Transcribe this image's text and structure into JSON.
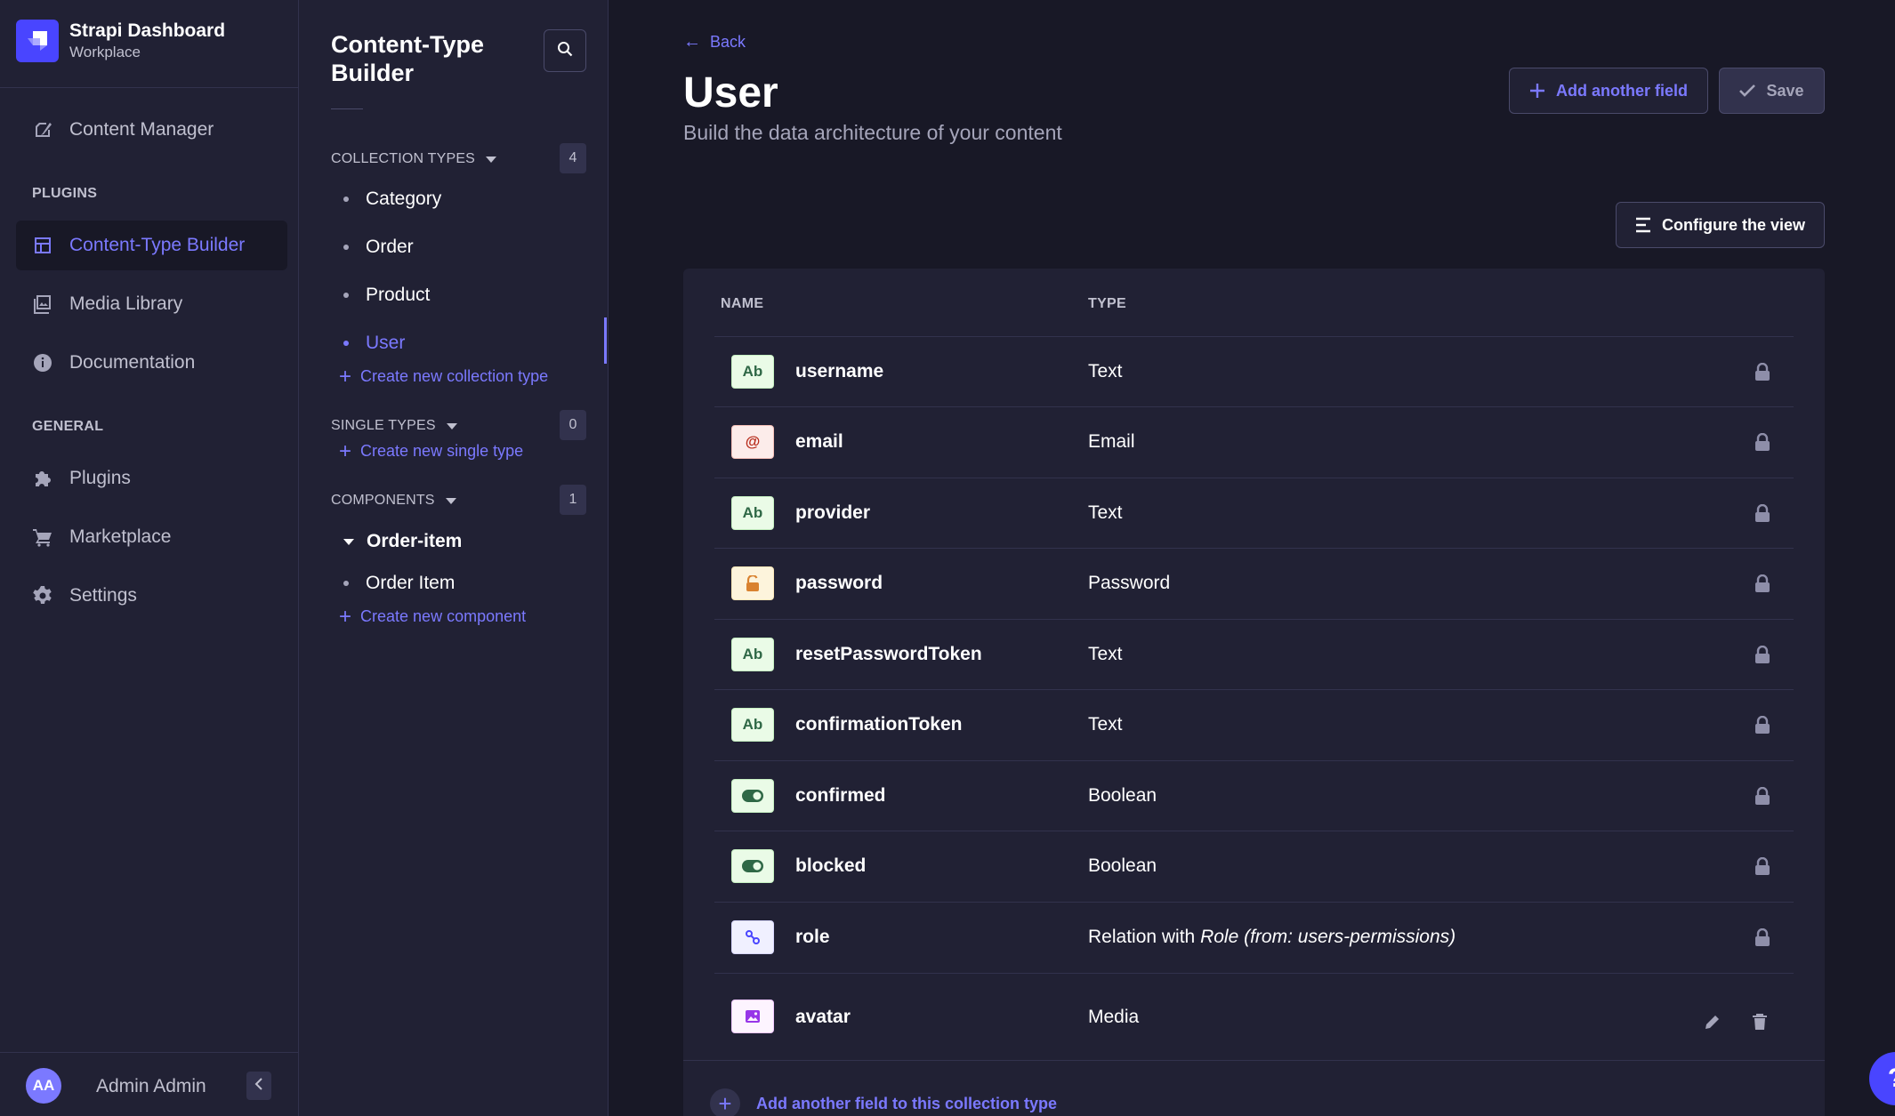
{
  "brand": {
    "title": "Strapi Dashboard",
    "subtitle": "Workplace"
  },
  "main_nav": {
    "content_manager": "Content Manager",
    "plugins_section": "PLUGINS",
    "content_type_builder": "Content-Type Builder",
    "media_library": "Media Library",
    "documentation": "Documentation",
    "general_section": "GENERAL",
    "plugins": "Plugins",
    "marketplace": "Marketplace",
    "settings": "Settings"
  },
  "user": {
    "initials": "AA",
    "name": "Admin Admin"
  },
  "sub_nav": {
    "title_line1": "Content-Type",
    "title_line2": "Builder",
    "collection_types": {
      "label": "COLLECTION TYPES",
      "count": "4",
      "items": [
        "Category",
        "Order",
        "Product",
        "User"
      ],
      "active": "User",
      "create": "Create new collection type"
    },
    "single_types": {
      "label": "SINGLE TYPES",
      "count": "0",
      "create": "Create new single type"
    },
    "components": {
      "label": "COMPONENTS",
      "count": "1",
      "group": "Order-item",
      "items": [
        "Order Item"
      ],
      "create": "Create new component"
    }
  },
  "header": {
    "back": "Back",
    "title": "User",
    "subtitle": "Build the data architecture of your content",
    "add_field": "Add another field",
    "save": "Save",
    "configure": "Configure the view"
  },
  "table": {
    "col_name": "NAME",
    "col_type": "TYPE",
    "rows": [
      {
        "name": "username",
        "type": "Text",
        "icon_label": "Ab"
      },
      {
        "name": "email",
        "type": "Email",
        "icon_label": "@"
      },
      {
        "name": "provider",
        "type": "Text",
        "icon_label": "Ab"
      },
      {
        "name": "password",
        "type": "Password"
      },
      {
        "name": "resetPasswordToken",
        "type": "Text",
        "icon_label": "Ab"
      },
      {
        "name": "confirmationToken",
        "type": "Text",
        "icon_label": "Ab"
      },
      {
        "name": "confirmed",
        "type": "Boolean"
      },
      {
        "name": "blocked",
        "type": "Boolean"
      },
      {
        "name": "role",
        "type_prefix": "Relation with",
        "type_target": "Role (from: users-permissions)"
      },
      {
        "name": "avatar",
        "type": "Media"
      }
    ],
    "footer_add": "Add another field to this collection type"
  },
  "help": "?",
  "colors": {
    "accent": "#7b79ff",
    "primary": "#4945ff",
    "background": "#181826",
    "surface": "#212134"
  }
}
